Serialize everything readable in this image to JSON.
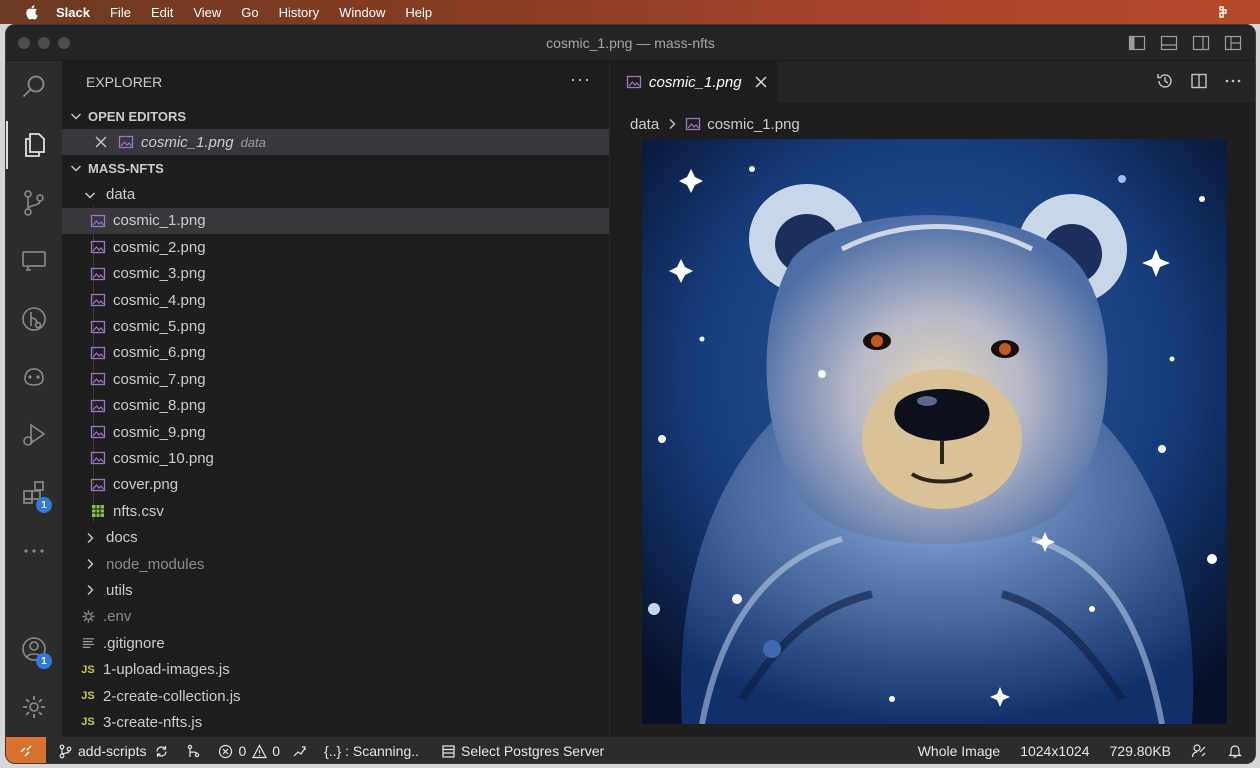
{
  "menubar": {
    "app": "Slack",
    "items": [
      "File",
      "Edit",
      "View",
      "Go",
      "History",
      "Window",
      "Help"
    ]
  },
  "window": {
    "title": "cosmic_1.png — mass-nfts"
  },
  "activity_bar": {
    "icons": [
      "search-icon",
      "explorer-icon",
      "source-control-icon",
      "remote-explorer-icon",
      "gitlens-icon",
      "copilot-icon",
      "run-debug-icon",
      "extensions-icon",
      "more-icon",
      "account-icon",
      "settings-icon"
    ],
    "extensions_badge": "1",
    "account_badge": "1"
  },
  "explorer": {
    "title": "EXPLORER",
    "open_editors_label": "OPEN EDITORS",
    "open_editor": {
      "name": "cosmic_1.png",
      "folder": "data"
    },
    "project_label": "MASS-NFTS",
    "data_folder": "data",
    "data_files": [
      {
        "name": "cosmic_1.png",
        "type": "image"
      },
      {
        "name": "cosmic_2.png",
        "type": "image"
      },
      {
        "name": "cosmic_3.png",
        "type": "image"
      },
      {
        "name": "cosmic_4.png",
        "type": "image"
      },
      {
        "name": "cosmic_5.png",
        "type": "image"
      },
      {
        "name": "cosmic_6.png",
        "type": "image"
      },
      {
        "name": "cosmic_7.png",
        "type": "image"
      },
      {
        "name": "cosmic_8.png",
        "type": "image"
      },
      {
        "name": "cosmic_9.png",
        "type": "image"
      },
      {
        "name": "cosmic_10.png",
        "type": "image"
      },
      {
        "name": "cover.png",
        "type": "image"
      },
      {
        "name": "nfts.csv",
        "type": "csv"
      }
    ],
    "folders": [
      "docs",
      "node_modules",
      "utils"
    ],
    "root_files": [
      {
        "name": ".env",
        "type": "env"
      },
      {
        "name": ".gitignore",
        "type": "text"
      },
      {
        "name": "1-upload-images.js",
        "type": "js"
      },
      {
        "name": "2-create-collection.js",
        "type": "js"
      },
      {
        "name": "3-create-nfts.js",
        "type": "js"
      }
    ],
    "js_tag": "JS"
  },
  "editor": {
    "tab_label": "cosmic_1.png",
    "breadcrumb": {
      "folder": "data",
      "file": "cosmic_1.png"
    }
  },
  "statusbar": {
    "branch": "add-scripts",
    "errors": "0",
    "warnings": "0",
    "scanning": "{..} : Scanning..",
    "postgres": "Select Postgres Server",
    "zoom": "Whole Image",
    "dimensions": "1024x1024",
    "filesize": "729.80KB"
  },
  "colors": {
    "accent_orange": "#d9722d",
    "badge_blue": "#2f7bd6",
    "image_icon": "#a074c4",
    "csv_icon": "#8bc34a",
    "js_yellow": "#cbcb41"
  }
}
